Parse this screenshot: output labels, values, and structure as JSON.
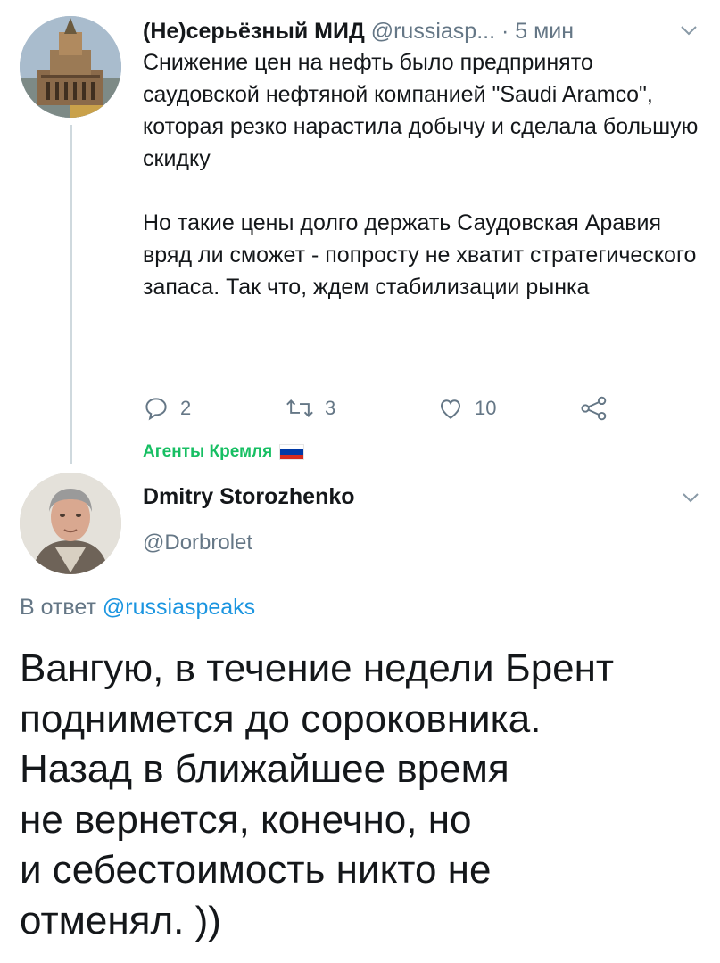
{
  "parent_tweet": {
    "author_name": "(Не)серьёзный МИД",
    "author_handle": "@russiasp...",
    "time": "· 5 мин",
    "paragraphs": [
      "Снижение цен на нефть было предпринято саудовской нефтяной компанией \"Saudi Aramco\", которая резко нарастила добычу и сделала большую скидку",
      "Но такие цены долго держать Саудовская Аравия вряд ли сможет - попросту не хватит стратегического запаса. Так что, ждем стабилизации рынка"
    ],
    "actions": {
      "reply_count": "2",
      "retweet_count": "3",
      "like_count": "10"
    }
  },
  "community_label": {
    "text": "Агенты Кремля",
    "flag_colors": [
      "#ffffff",
      "#0039a6",
      "#d52b1e"
    ]
  },
  "reply_tweet": {
    "author_name": "Dmitry Storozhenko",
    "author_handle": "@Dorbrolet",
    "reply_prefix": "В ответ ",
    "reply_to": "@russiaspeaks",
    "text": "Вангую, в течение недели Брент\nподнимется до сороковника.\nНазад в ближайшее время\nне вернется, конечно, но\nи себестоимость никто не\nотменял. ))"
  },
  "colors": {
    "link": "#1b95e0",
    "muted": "#657786",
    "community": "#17bf63",
    "thread_line": "#cfd9de"
  },
  "icons": [
    "reply-icon",
    "retweet-icon",
    "like-icon",
    "share-icon",
    "chevron-down-icon"
  ]
}
